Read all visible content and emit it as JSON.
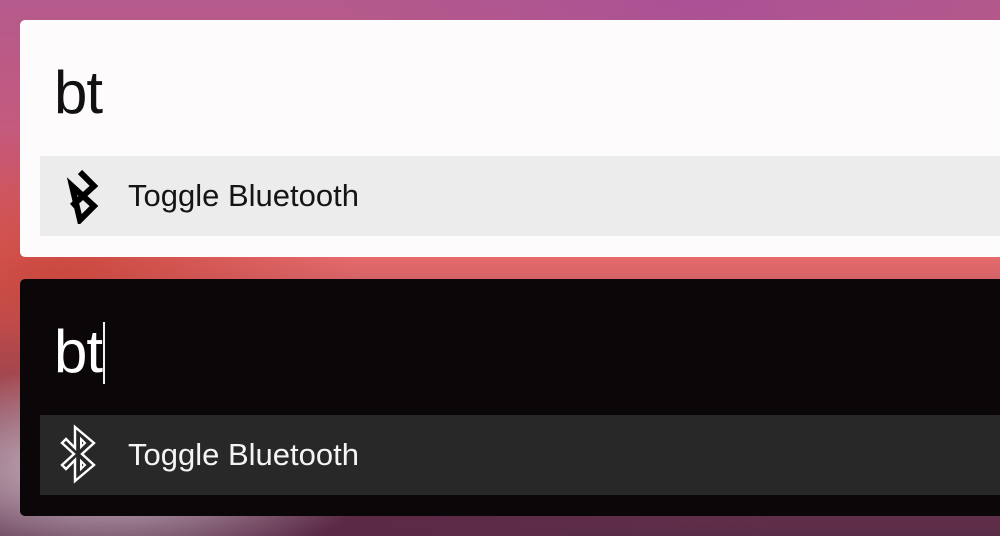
{
  "light_panel": {
    "query": "bt",
    "result": {
      "icon": "bluetooth-icon",
      "label": "Toggle Bluetooth"
    }
  },
  "dark_panel": {
    "query": "bt",
    "result": {
      "icon": "bluetooth-outline-icon",
      "label": "Toggle Bluetooth"
    }
  },
  "colors": {
    "light_panel_bg": "#fefbfc",
    "light_result_bg": "#ececec",
    "dark_panel_bg": "#0b0607",
    "dark_result_bg": "#282828"
  }
}
